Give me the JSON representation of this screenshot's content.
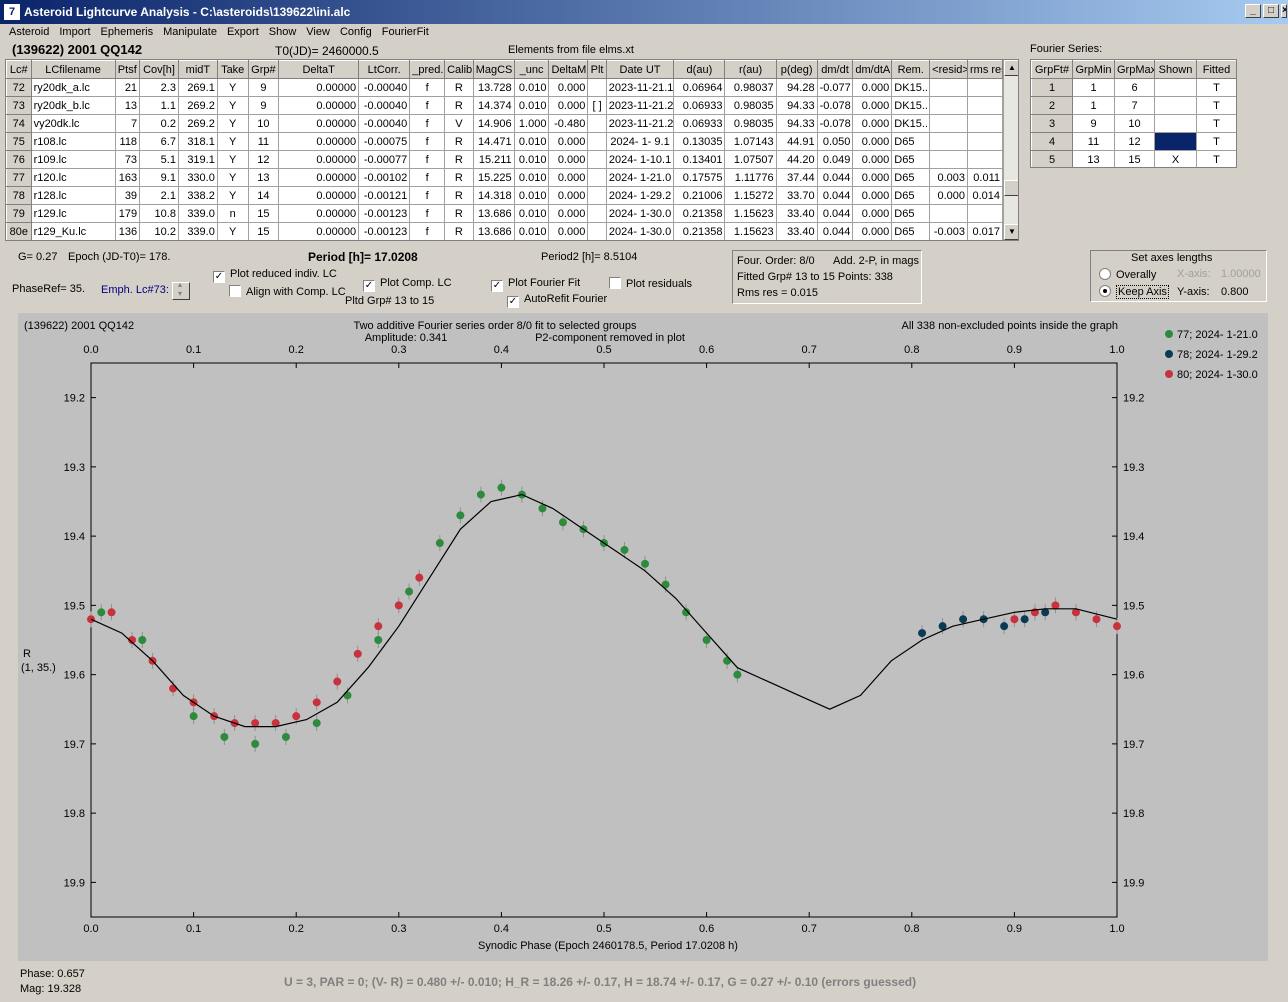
{
  "window": {
    "title": "Asteroid Lightcurve Analysis - C:\\asteroids\\139622\\ini.alc",
    "icon_text": "7"
  },
  "menu": [
    "Asteroid",
    "Import",
    "Ephemeris",
    "Manipulate",
    "Export",
    "Show",
    "View",
    "Config",
    "FourierFit"
  ],
  "header": {
    "object_name": "(139622) 2001 QQ142",
    "t0": "T0(JD)= 2460000.5",
    "elements": "Elements from file elms.xt",
    "fourier_label": "Fourier Series:"
  },
  "lc_table": {
    "columns": [
      "Lc#",
      "LCfilename",
      "Ptsf",
      "Cov[h]",
      "midT",
      "Take",
      "Grp#",
      "DeltaT",
      "LtCorr.",
      "_pred.",
      "Calib.",
      "MagCS",
      "_unc",
      "DeltaM",
      "Plt",
      "Date UT",
      "d(au)",
      "r(au)",
      "p(deg)",
      "dm/dt",
      "dm/dtA",
      "Rem.",
      "<resid>",
      "rms res"
    ],
    "rows": [
      [
        "72",
        "ry20dk_a.lc",
        "21",
        "2.3",
        "269.1",
        "Y",
        "9",
        "0.00000",
        "-0.00040",
        "f",
        "R",
        "13.728",
        "0.010",
        "0.000",
        "",
        "2023-11-21.1",
        "0.06964",
        "0.98037",
        "94.28",
        "-0.077",
        "0.000",
        "DK15..",
        "",
        ""
      ],
      [
        "73",
        "ry20dk_b.lc",
        "13",
        "1.1",
        "269.2",
        "Y",
        "9",
        "0.00000",
        "-0.00040",
        "f",
        "R",
        "14.374",
        "0.010",
        "0.000",
        "[ ]",
        "2023-11-21.2",
        "0.06933",
        "0.98035",
        "94.33",
        "-0.078",
        "0.000",
        "DK15..",
        "",
        ""
      ],
      [
        "74",
        "vy20dk.lc",
        "7",
        "0.2",
        "269.2",
        "Y",
        "10",
        "0.00000",
        "-0.00040",
        "f",
        "V",
        "14.906",
        "1.000",
        "-0.480",
        "",
        "2023-11-21.2",
        "0.06933",
        "0.98035",
        "94.33",
        "-0.078",
        "0.000",
        "DK15..",
        "",
        ""
      ],
      [
        "75",
        "r108.lc",
        "118",
        "6.7",
        "318.1",
        "Y",
        "11",
        "0.00000",
        "-0.00075",
        "f",
        "R",
        "14.471",
        "0.010",
        "0.000",
        "",
        "2024- 1- 9.1",
        "0.13035",
        "1.07143",
        "44.91",
        "0.050",
        "0.000",
        "D65",
        "",
        ""
      ],
      [
        "76",
        "r109.lc",
        "73",
        "5.1",
        "319.1",
        "Y",
        "12",
        "0.00000",
        "-0.00077",
        "f",
        "R",
        "15.211",
        "0.010",
        "0.000",
        "",
        "2024- 1-10.1",
        "0.13401",
        "1.07507",
        "44.20",
        "0.049",
        "0.000",
        "D65",
        "",
        ""
      ],
      [
        "77",
        "r120.lc",
        "163",
        "9.1",
        "330.0",
        "Y",
        "13",
        "0.00000",
        "-0.00102",
        "f",
        "R",
        "15.225",
        "0.010",
        "0.000",
        "",
        "2024- 1-21.0",
        "0.17575",
        "1.11776",
        "37.44",
        "0.044",
        "0.000",
        "D65",
        "0.003",
        "0.011"
      ],
      [
        "78",
        "r128.lc",
        "39",
        "2.1",
        "338.2",
        "Y",
        "14",
        "0.00000",
        "-0.00121",
        "f",
        "R",
        "14.318",
        "0.010",
        "0.000",
        "",
        "2024- 1-29.2",
        "0.21006",
        "1.15272",
        "33.70",
        "0.044",
        "0.000",
        "D65",
        "0.000",
        "0.014"
      ],
      [
        "79",
        "r129.lc",
        "179",
        "10.8",
        "339.0",
        "n",
        "15",
        "0.00000",
        "-0.00123",
        "f",
        "R",
        "13.686",
        "0.010",
        "0.000",
        "",
        "2024- 1-30.0",
        "0.21358",
        "1.15623",
        "33.40",
        "0.044",
        "0.000",
        "D65",
        "",
        ""
      ],
      [
        "80e",
        "r129_Ku.lc",
        "136",
        "10.2",
        "339.0",
        "Y",
        "15",
        "0.00000",
        "-0.00123",
        "f",
        "R",
        "13.686",
        "0.010",
        "0.000",
        "",
        "2024- 1-30.0",
        "0.21358",
        "1.15623",
        "33.40",
        "0.044",
        "0.000",
        "D65",
        "-0.003",
        "0.017"
      ]
    ]
  },
  "fourier_table": {
    "columns": [
      "GrpFt#",
      "GrpMin",
      "GrpMax",
      "Shown",
      "Fitted"
    ],
    "rows": [
      [
        "1",
        "1",
        "6",
        "",
        "T"
      ],
      [
        "2",
        "1",
        "7",
        "",
        "T"
      ],
      [
        "3",
        "9",
        "10",
        "",
        "T"
      ],
      [
        "4",
        "11",
        "12",
        "",
        "T"
      ],
      [
        "5",
        "13",
        "15",
        "X",
        "T"
      ]
    ]
  },
  "controls": {
    "g_value": "G= 0.27",
    "epoch": "Epoch (JD-T0)= 178.",
    "period": "Period [h]= 17.0208",
    "period2": "Period2 [h]= 8.5104",
    "phase_ref": "PhaseRef= 35.",
    "emph_lc": "Emph. Lc#73:",
    "plot_reduced": "Plot reduced indiv. LC",
    "align_comp": "Align with Comp. LC",
    "plot_comp": "Plot Comp. LC",
    "pltd_grp": "Pltd Grp#  13 to   15",
    "plot_fourier": "Plot Fourier Fit",
    "plot_residuals": "Plot residuals",
    "autorefit": "AutoRefit Fourier",
    "four_order": "Four. Order:  8/0",
    "add_2p": "Add. 2-P, in mags",
    "fitted_grp": "Fitted Grp# 13 to 15 Points: 338",
    "rms_res": "Rms res     = 0.015",
    "axes_title": "Set axes lengths",
    "overally": "Overally",
    "keep_axis": "Keep Axis",
    "x_axis_label": "X-axis:",
    "x_axis_value": "1.00000",
    "y_axis_label": "Y-axis:",
    "y_axis_value": "0.800"
  },
  "chart_data": {
    "type": "scatter",
    "object": "(139622) 2001 QQ142",
    "title": "Two additive Fourier series order 8/0 fit to selected groups",
    "subtitle": "Amplitude: 0.341",
    "note_p2": "P2-component removed in plot",
    "note_points": "All 338 non-excluded points inside the graph",
    "xlabel": "Synodic Phase (Epoch 2460178.5, Period 17.0208 h)",
    "ylabel": "R",
    "ylabel2": "(1, 35.)",
    "xlim": [
      0.0,
      1.0
    ],
    "ylim": [
      19.15,
      19.95
    ],
    "y_inverted": true,
    "x_ticks": [
      "0.0",
      "0.1",
      "0.2",
      "0.3",
      "0.4",
      "0.5",
      "0.6",
      "0.7",
      "0.8",
      "0.9",
      "1.0"
    ],
    "y_ticks": [
      "19.2",
      "19.3",
      "19.4",
      "19.5",
      "19.6",
      "19.7",
      "19.8",
      "19.9"
    ],
    "legend_position": "right",
    "series": [
      {
        "name": "77; 2024- 1-21.0",
        "color": "#2e8b3e",
        "points": [
          [
            0.01,
            19.51
          ],
          [
            0.05,
            19.55
          ],
          [
            0.1,
            19.66
          ],
          [
            0.13,
            19.69
          ],
          [
            0.16,
            19.7
          ],
          [
            0.19,
            19.69
          ],
          [
            0.22,
            19.67
          ],
          [
            0.25,
            19.63
          ],
          [
            0.28,
            19.55
          ],
          [
            0.31,
            19.48
          ],
          [
            0.34,
            19.41
          ],
          [
            0.36,
            19.37
          ],
          [
            0.38,
            19.34
          ],
          [
            0.4,
            19.33
          ],
          [
            0.42,
            19.34
          ],
          [
            0.44,
            19.36
          ],
          [
            0.46,
            19.38
          ],
          [
            0.48,
            19.39
          ],
          [
            0.5,
            19.41
          ],
          [
            0.52,
            19.42
          ],
          [
            0.54,
            19.44
          ],
          [
            0.56,
            19.47
          ],
          [
            0.58,
            19.51
          ],
          [
            0.6,
            19.55
          ],
          [
            0.62,
            19.58
          ],
          [
            0.63,
            19.6
          ]
        ]
      },
      {
        "name": "78; 2024- 1-29.2",
        "color": "#0b3a55",
        "points": [
          [
            0.81,
            19.54
          ],
          [
            0.83,
            19.53
          ],
          [
            0.85,
            19.52
          ],
          [
            0.87,
            19.52
          ],
          [
            0.89,
            19.53
          ],
          [
            0.91,
            19.52
          ],
          [
            0.93,
            19.51
          ]
        ]
      },
      {
        "name": "80; 2024- 1-30.0",
        "color": "#c8323c",
        "points": [
          [
            0.0,
            19.52
          ],
          [
            0.02,
            19.51
          ],
          [
            0.04,
            19.55
          ],
          [
            0.06,
            19.58
          ],
          [
            0.08,
            19.62
          ],
          [
            0.1,
            19.64
          ],
          [
            0.12,
            19.66
          ],
          [
            0.14,
            19.67
          ],
          [
            0.16,
            19.67
          ],
          [
            0.18,
            19.67
          ],
          [
            0.2,
            19.66
          ],
          [
            0.22,
            19.64
          ],
          [
            0.24,
            19.61
          ],
          [
            0.26,
            19.57
          ],
          [
            0.28,
            19.53
          ],
          [
            0.3,
            19.5
          ],
          [
            0.32,
            19.46
          ],
          [
            0.9,
            19.52
          ],
          [
            0.92,
            19.51
          ],
          [
            0.94,
            19.5
          ],
          [
            0.96,
            19.51
          ],
          [
            0.98,
            19.52
          ],
          [
            1.0,
            19.53
          ]
        ]
      }
    ],
    "fit_curve": [
      [
        0.0,
        19.52
      ],
      [
        0.03,
        19.54
      ],
      [
        0.06,
        19.58
      ],
      [
        0.09,
        19.63
      ],
      [
        0.12,
        19.66
      ],
      [
        0.15,
        19.675
      ],
      [
        0.18,
        19.675
      ],
      [
        0.21,
        19.665
      ],
      [
        0.24,
        19.64
      ],
      [
        0.27,
        19.59
      ],
      [
        0.3,
        19.53
      ],
      [
        0.33,
        19.46
      ],
      [
        0.36,
        19.39
      ],
      [
        0.39,
        19.35
      ],
      [
        0.42,
        19.34
      ],
      [
        0.45,
        19.36
      ],
      [
        0.48,
        19.39
      ],
      [
        0.51,
        19.42
      ],
      [
        0.54,
        19.45
      ],
      [
        0.57,
        19.49
      ],
      [
        0.6,
        19.54
      ],
      [
        0.63,
        19.59
      ],
      [
        0.66,
        19.61
      ],
      [
        0.69,
        19.63
      ],
      [
        0.72,
        19.65
      ],
      [
        0.75,
        19.63
      ],
      [
        0.78,
        19.58
      ],
      [
        0.81,
        19.55
      ],
      [
        0.84,
        19.53
      ],
      [
        0.87,
        19.52
      ],
      [
        0.9,
        19.51
      ],
      [
        0.93,
        19.505
      ],
      [
        0.96,
        19.505
      ],
      [
        1.0,
        19.52
      ]
    ]
  },
  "footer": {
    "phase": "Phase:  0.657",
    "mag": "Mag:    19.328",
    "summary": "U = 3, PAR = 0; (V- R) = 0.480 +/- 0.010; H_R = 18.26 +/- 0.17, H = 18.74 +/- 0.17, G = 0.27 +/- 0.10 (errors guessed)"
  }
}
